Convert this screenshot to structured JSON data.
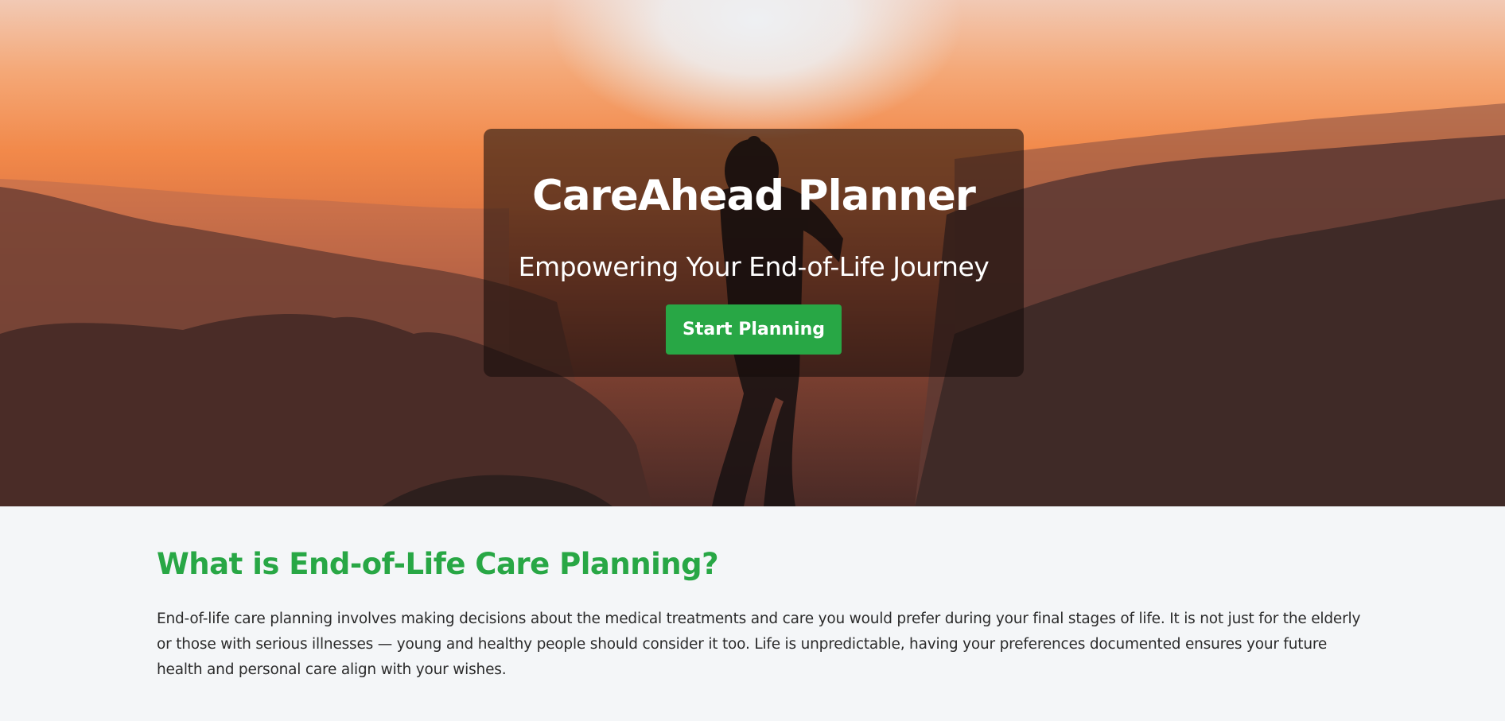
{
  "hero": {
    "title": "CareAhead Planner",
    "subtitle": "Empowering Your End-of-Life Journey",
    "cta_label": "Start Planning"
  },
  "info": {
    "heading": "What is End-of-Life Care Planning?",
    "paragraph": "End-of-life care planning involves making decisions about the medical treatments and care you would prefer during your final stages of life. It is not just for the elderly or those with serious illnesses — young and healthy people should consider it too. Life is unpredictable, having your preferences documented ensures your future health and personal care align with your wishes."
  },
  "colors": {
    "accent": "#28a745",
    "page_background": "#f4f6f8",
    "text": "#2b2b2b"
  }
}
